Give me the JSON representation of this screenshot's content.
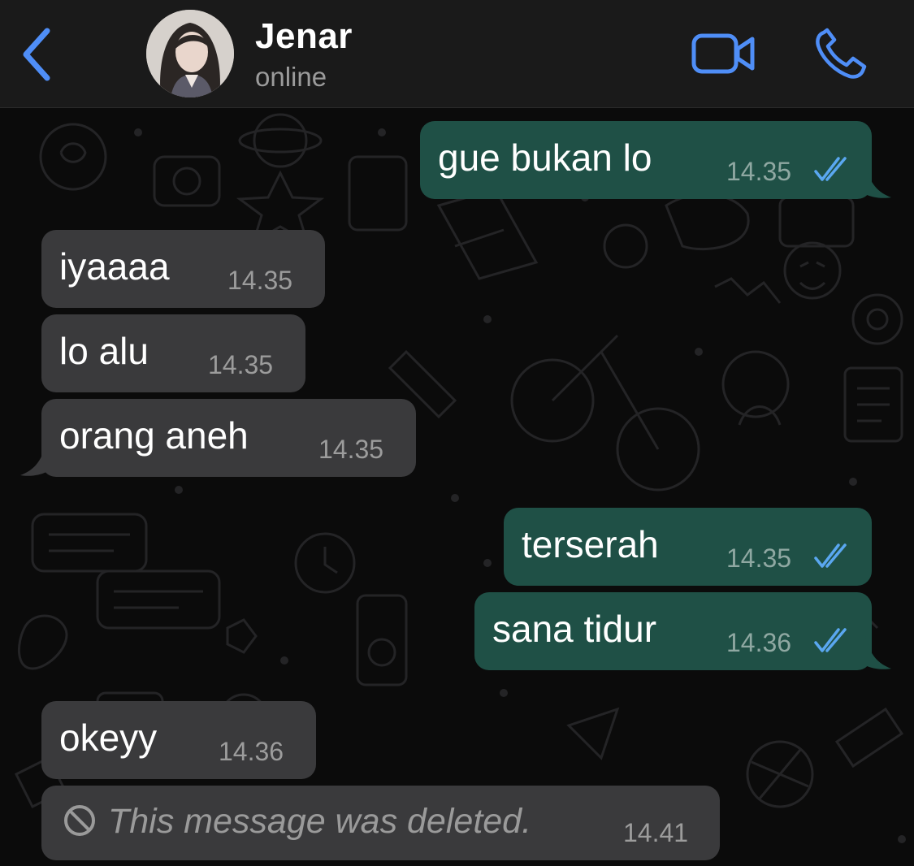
{
  "header": {
    "contact_name": "Jenar",
    "contact_status": "online",
    "back_icon": "chevron-left-icon",
    "video_icon": "video-camera-icon",
    "call_icon": "phone-icon",
    "accent_color": "#4f8ef7"
  },
  "messages": [
    {
      "direction": "out",
      "text": "gue bukan lo",
      "time": "14.35",
      "status": "read"
    },
    {
      "direction": "in",
      "text": "iyaaaa",
      "time": "14.35"
    },
    {
      "direction": "in",
      "text": "lo alu",
      "time": "14.35"
    },
    {
      "direction": "in",
      "text": "orang aneh",
      "time": "14.35"
    },
    {
      "direction": "out",
      "text": "terserah",
      "time": "14.35",
      "status": "read"
    },
    {
      "direction": "out",
      "text": "sana tidur",
      "time": "14.36",
      "status": "read"
    },
    {
      "direction": "in",
      "text": "okeyy",
      "time": "14.36"
    },
    {
      "direction": "in",
      "text": "This message was deleted.",
      "time": "14.41",
      "deleted": true
    }
  ],
  "colors": {
    "incoming_bubble": "#3a3a3c",
    "outgoing_bubble": "#1f5046",
    "read_ticks": "#5aa7f0",
    "background": "#0b0b0b"
  }
}
